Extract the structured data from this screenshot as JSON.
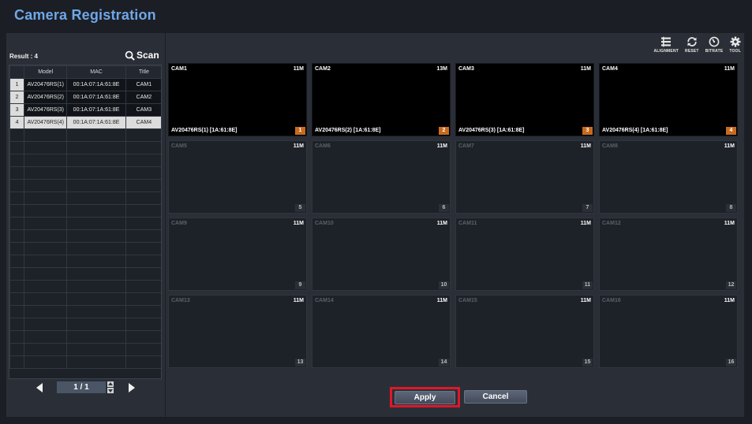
{
  "title": "Camera Registration",
  "left": {
    "result_label": "Result : 4",
    "scan_label": "Scan",
    "columns": [
      "",
      "Model",
      "MAC",
      "Title"
    ],
    "rows": [
      {
        "idx": "1",
        "model": "AV20476RS(1)",
        "mac": "00:1A:07:1A:61:8E",
        "title": "CAM1"
      },
      {
        "idx": "2",
        "model": "AV20476RS(2)",
        "mac": "00:1A:07:1A:61:8E",
        "title": "CAM2"
      },
      {
        "idx": "3",
        "model": "AV20476RS(3)",
        "mac": "00:1A:07:1A:61:8E",
        "title": "CAM3"
      },
      {
        "idx": "4",
        "model": "AV20476RS(4)",
        "mac": "00:1A:07:1A:61:8E",
        "title": "CAM4"
      }
    ],
    "selected_row": 4,
    "page_indicator": "1 / 1"
  },
  "toolbar": {
    "alignment": "ALIGNMENT",
    "reset": "RESET",
    "bitrate": "BITRATE",
    "tool": "TOOL"
  },
  "tiles": [
    {
      "cam": "CAM1",
      "res": "11M",
      "num": "1",
      "device": "AV20476RS(1) [1A:61:8E]",
      "active": true
    },
    {
      "cam": "CAM2",
      "res": "13M",
      "num": "2",
      "device": "AV20476RS(2) [1A:61:8E]",
      "active": true
    },
    {
      "cam": "CAM3",
      "res": "11M",
      "num": "3",
      "device": "AV20476RS(3) [1A:61:8E]",
      "active": true
    },
    {
      "cam": "CAM4",
      "res": "11M",
      "num": "4",
      "device": "AV20476RS(4) [1A:61:8E]",
      "active": true
    },
    {
      "cam": "CAM5",
      "res": "11M",
      "num": "5",
      "device": "",
      "active": false
    },
    {
      "cam": "CAM6",
      "res": "11M",
      "num": "6",
      "device": "",
      "active": false
    },
    {
      "cam": "CAM7",
      "res": "11M",
      "num": "7",
      "device": "",
      "active": false
    },
    {
      "cam": "CAM8",
      "res": "11M",
      "num": "8",
      "device": "",
      "active": false
    },
    {
      "cam": "CAM9",
      "res": "11M",
      "num": "9",
      "device": "",
      "active": false
    },
    {
      "cam": "CAM10",
      "res": "11M",
      "num": "10",
      "device": "",
      "active": false
    },
    {
      "cam": "CAM11",
      "res": "11M",
      "num": "11",
      "device": "",
      "active": false
    },
    {
      "cam": "CAM12",
      "res": "11M",
      "num": "12",
      "device": "",
      "active": false
    },
    {
      "cam": "CAM13",
      "res": "11M",
      "num": "13",
      "device": "",
      "active": false
    },
    {
      "cam": "CAM14",
      "res": "11M",
      "num": "14",
      "device": "",
      "active": false
    },
    {
      "cam": "CAM15",
      "res": "11M",
      "num": "15",
      "device": "",
      "active": false
    },
    {
      "cam": "CAM16",
      "res": "11M",
      "num": "16",
      "device": "",
      "active": false
    }
  ],
  "buttons": {
    "apply": "Apply",
    "cancel": "Cancel"
  },
  "colors": {
    "accent_title": "#6fa7e6",
    "badge_active": "#c86a1e",
    "highlight_border": "#e0162a"
  }
}
